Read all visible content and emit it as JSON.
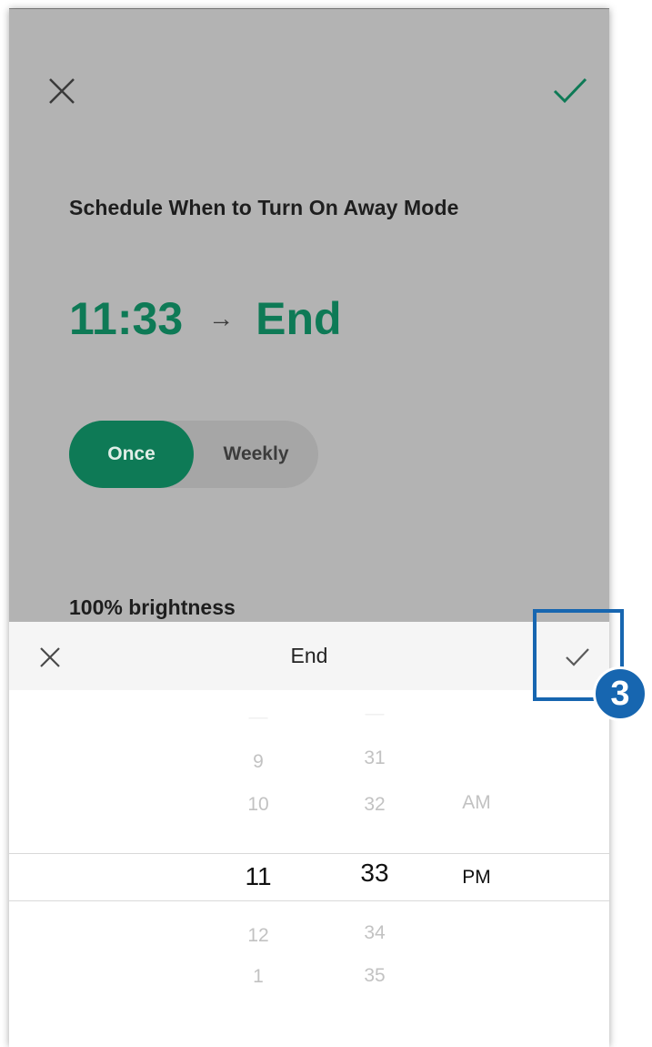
{
  "background_screen": {
    "title": "Schedule When to Turn On Away Mode",
    "start_time": "11:33",
    "arrow": "→",
    "end_label": "End",
    "repeat_options": [
      "Once",
      "Weekly"
    ],
    "repeat_selected": "Once",
    "brightness_label": "100% brightness"
  },
  "time_picker_sheet": {
    "title": "End",
    "hours": {
      "above": [
        "9",
        "10"
      ],
      "selected": "11",
      "below": [
        "12",
        "1"
      ]
    },
    "minutes": {
      "above": [
        "31",
        "32"
      ],
      "selected": "33",
      "below": [
        "34",
        "35"
      ]
    },
    "period": {
      "above": "AM",
      "selected": "PM"
    }
  },
  "annotation": {
    "step_number": "3"
  },
  "colors": {
    "accent_green": "#0e7a56",
    "dim_overlay": "#b3b3b3",
    "annotation_blue": "#1766b0"
  },
  "icons": [
    "close-icon",
    "check-icon"
  ]
}
